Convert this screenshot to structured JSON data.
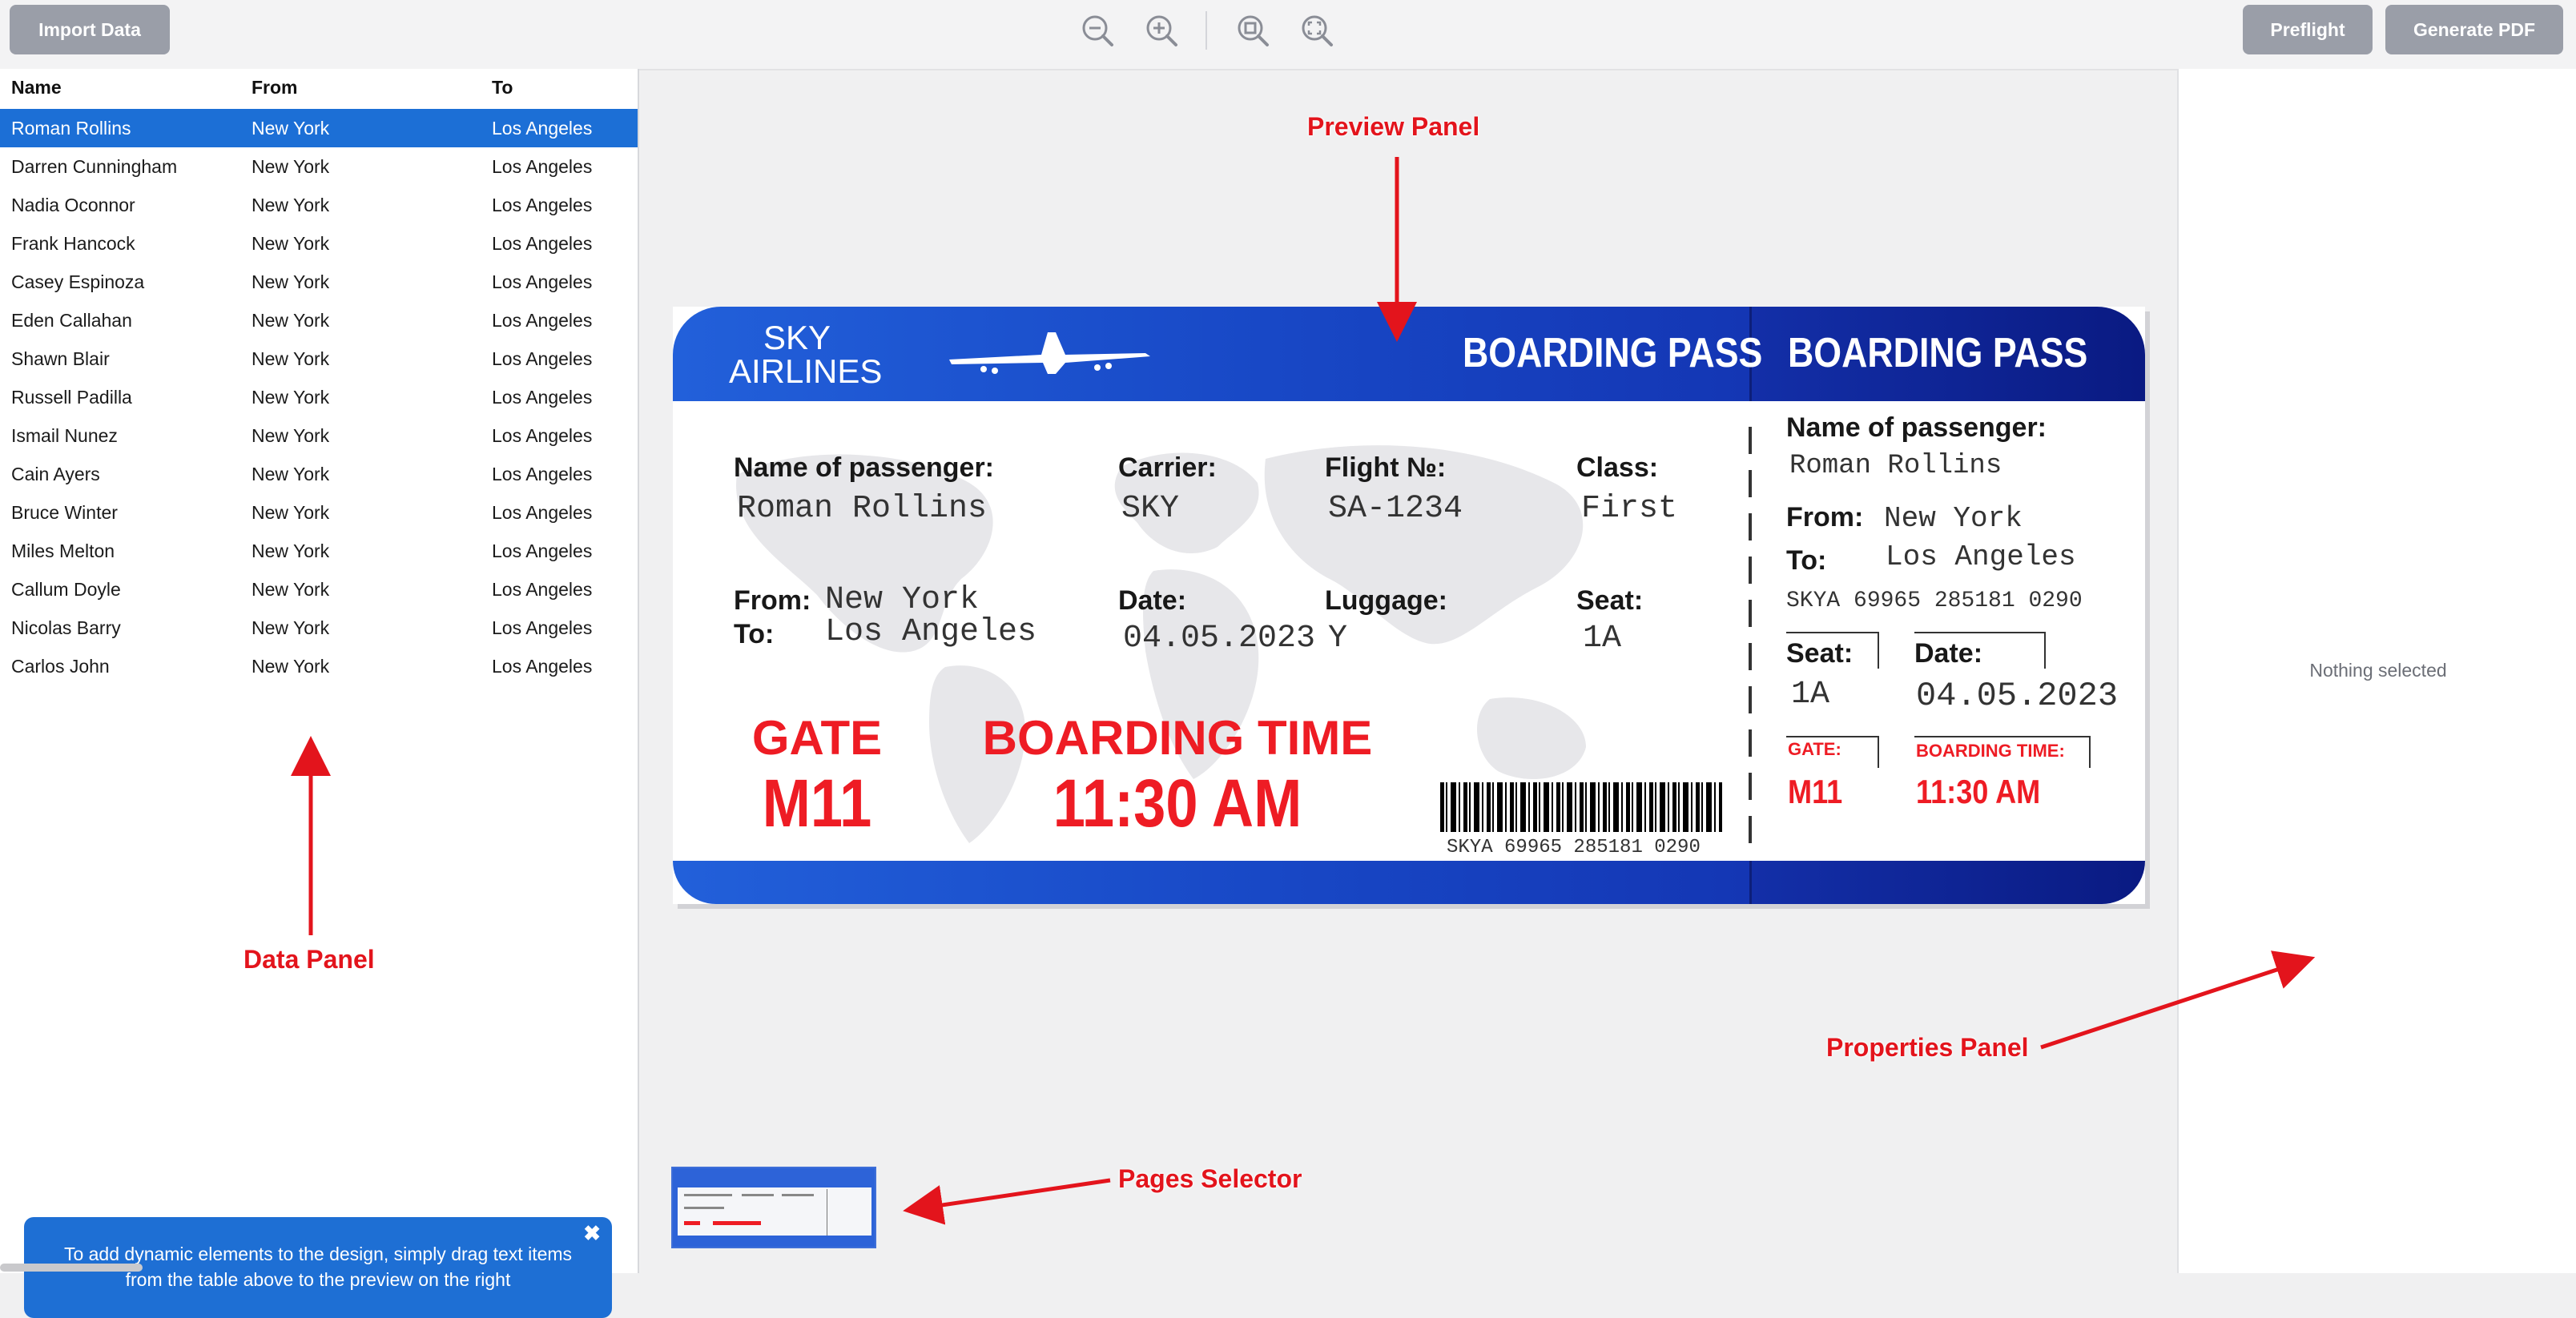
{
  "toolbar": {
    "import_label": "Import Data",
    "preflight_label": "Preflight",
    "generate_label": "Generate PDF"
  },
  "data_panel": {
    "columns": [
      "Name",
      "From",
      "To"
    ],
    "rows": [
      [
        "Roman Rollins",
        "New York",
        "Los Angeles"
      ],
      [
        "Darren Cunningham",
        "New York",
        "Los Angeles"
      ],
      [
        "Nadia Oconnor",
        "New York",
        "Los Angeles"
      ],
      [
        "Frank Hancock",
        "New York",
        "Los Angeles"
      ],
      [
        "Casey Espinoza",
        "New York",
        "Los Angeles"
      ],
      [
        "Eden Callahan",
        "New York",
        "Los Angeles"
      ],
      [
        "Shawn Blair",
        "New York",
        "Los Angeles"
      ],
      [
        "Russell Padilla",
        "New York",
        "Los Angeles"
      ],
      [
        "Ismail Nunez",
        "New York",
        "Los Angeles"
      ],
      [
        "Cain Ayers",
        "New York",
        "Los Angeles"
      ],
      [
        "Bruce Winter",
        "New York",
        "Los Angeles"
      ],
      [
        "Miles Melton",
        "New York",
        "Los Angeles"
      ],
      [
        "Callum Doyle",
        "New York",
        "Los Angeles"
      ],
      [
        "Nicolas Barry",
        "New York",
        "Los Angeles"
      ],
      [
        "Carlos John",
        "New York",
        "Los Angeles"
      ]
    ],
    "selected_row": 0,
    "tip": "To add dynamic elements to the design, simply drag text items from the table above to the preview on the right",
    "tip_close": "✖"
  },
  "properties": {
    "empty_text": "Nothing selected"
  },
  "annotations": {
    "preview": "Preview Panel",
    "data": "Data Panel",
    "properties": "Properties Panel",
    "pages": "Pages Selector"
  },
  "ticket": {
    "logo_line1": "SKY",
    "logo_line2": "AIRLINES",
    "title_main": "BOARDING PASS",
    "title_stub": "BOARDING PASS",
    "passenger_label": "Name of passenger:",
    "passenger": "Roman Rollins",
    "carrier_label": "Carrier:",
    "carrier": "SKY",
    "flight_label": "Flight №:",
    "flight": "SA-1234",
    "class_label": "Class:",
    "class": "First",
    "from_label": "From:",
    "from": "New York",
    "to_label": "To:",
    "to": "Los Angeles",
    "date_label": "Date:",
    "date": "04.05.2023",
    "luggage_label": "Luggage:",
    "luggage": "Y",
    "seat_label": "Seat:",
    "seat": "1A",
    "gate_label": "GATE",
    "gate": "M11",
    "boarding_label": "BOARDING TIME",
    "boarding_time": "11:30 AM",
    "barcode_text": "SKYA 69965 285181 0290",
    "stub_gate_label": "GATE:",
    "stub_boarding_label": "BOARDING TIME:",
    "colors": {
      "header": "#1848c6",
      "header_dark": "#0a1a82",
      "accent_red": "#ee1c24"
    }
  }
}
